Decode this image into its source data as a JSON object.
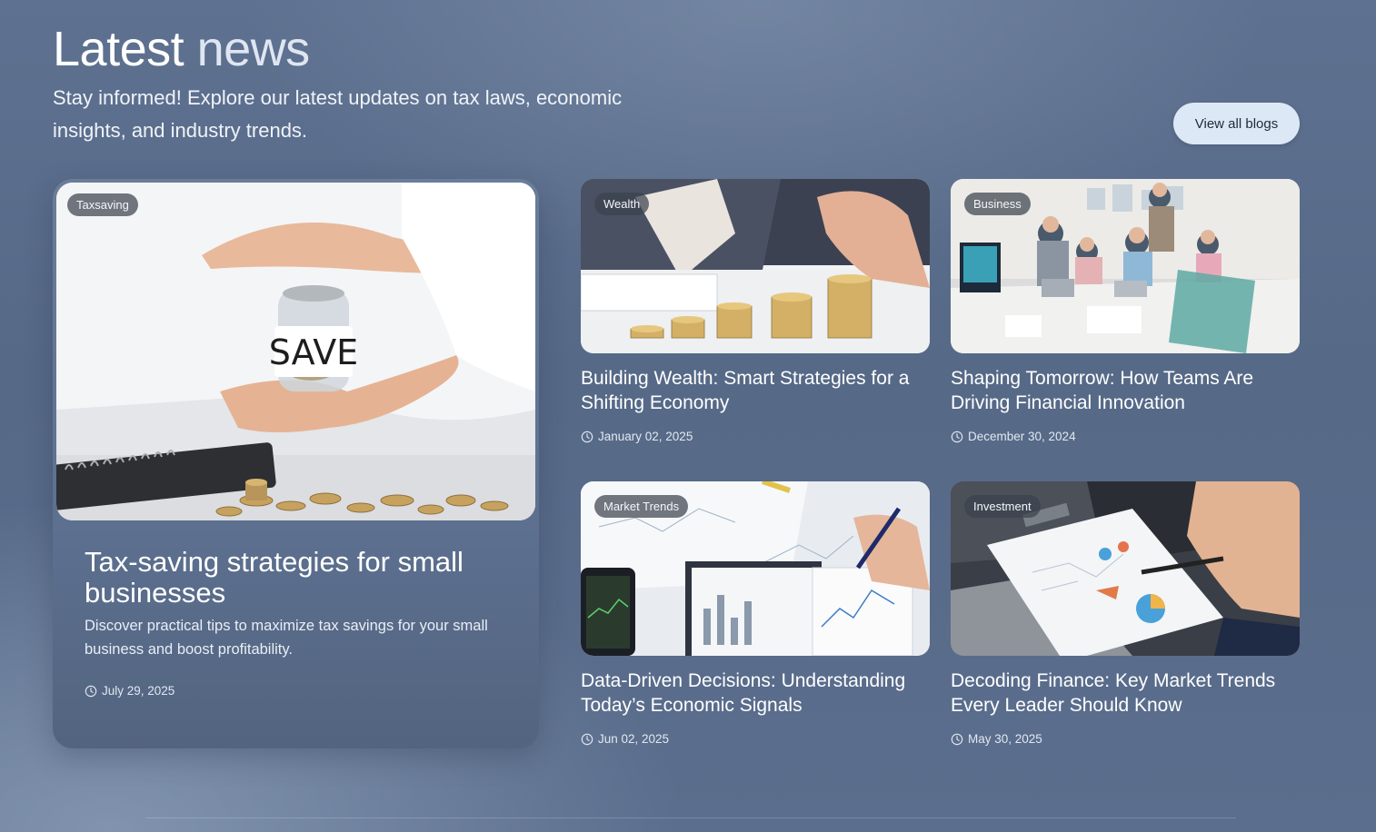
{
  "header": {
    "title_word1": "Latest",
    "title_word2": "news",
    "subtitle": "Stay informed! Explore our latest updates on tax laws, economic insights, and industry trends.",
    "view_all_label": "View all blogs"
  },
  "featured": {
    "tag": "Taxsaving",
    "title": "Tax-saving strategies for small businesses",
    "description": "Discover practical tips to maximize tax savings for your small business and boost profitability.",
    "date": "July 29, 2025",
    "image_text": "SAVE"
  },
  "posts": [
    {
      "tag": "Wealth",
      "title": "Building Wealth: Smart Strategies for a Shifting Economy",
      "date": "January 02, 2025"
    },
    {
      "tag": "Business",
      "title": "Shaping Tomorrow: How Teams Are Driving Financial Innovation",
      "date": "December 30, 2024"
    },
    {
      "tag": "Market Trends",
      "title": "Data-Driven Decisions: Understanding Today’s Economic Signals",
      "date": "Jun 02, 2025"
    },
    {
      "tag": "Investment",
      "title": "Decoding Finance: Key Market Trends Every Leader Should Know",
      "date": "May 30, 2025"
    }
  ],
  "icons": {
    "date": "clock-icon"
  },
  "colors": {
    "background": "#5e7190",
    "button_bg": "#dde8f7",
    "button_text": "#1f2a3a",
    "badge_bg": "#3c424e"
  }
}
